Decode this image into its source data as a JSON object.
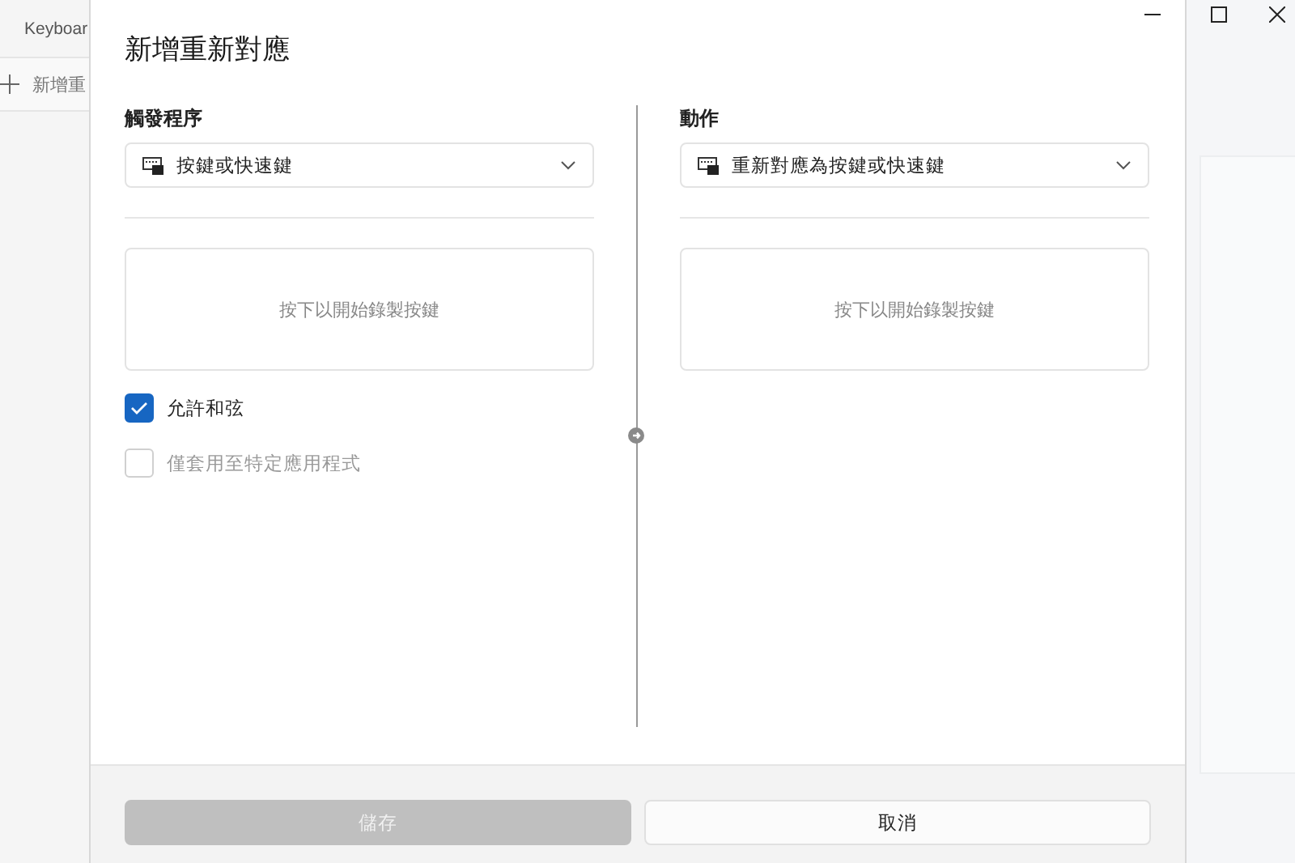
{
  "background_app": {
    "title": "Keyboar",
    "add_button": "新增重"
  },
  "dialog": {
    "title": "新增重新對應",
    "columns": [
      {
        "label": "觸發程序",
        "dropdown": "按鍵或快速鍵",
        "record_prompt": "按下以開始錄製按鍵"
      },
      {
        "label": "動作",
        "dropdown": "重新對應為按鍵或快速鍵",
        "record_prompt": "按下以開始錄製按鍵"
      }
    ],
    "options": [
      {
        "label": "允許和弦",
        "checked": true,
        "disabled": false
      },
      {
        "label": "僅套用至特定應用程式",
        "checked": false,
        "disabled": true
      }
    ],
    "buttons": [
      {
        "label": "儲存",
        "disabled": true
      },
      {
        "label": "取消",
        "disabled": false
      }
    ]
  }
}
